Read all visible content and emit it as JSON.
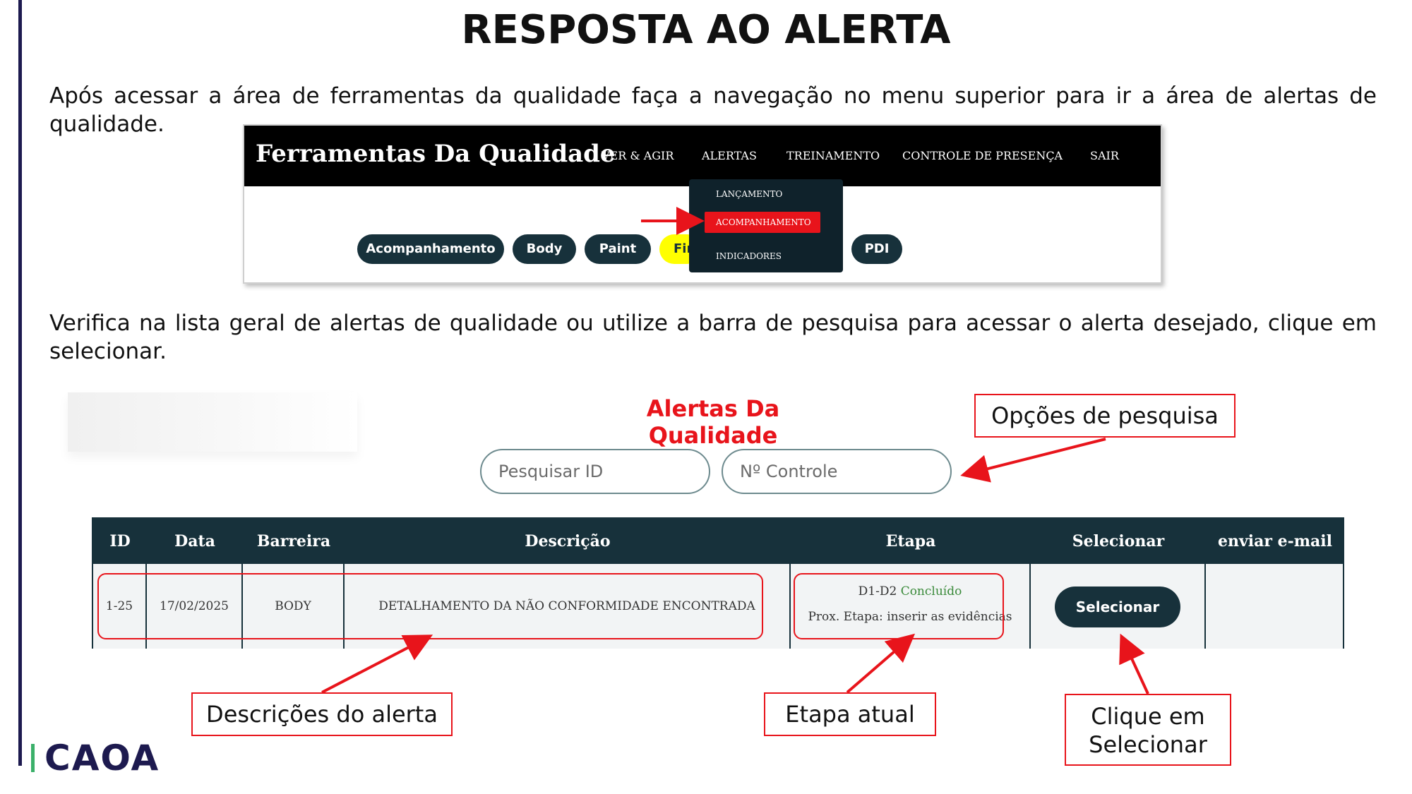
{
  "slide": {
    "title": "RESPOSTA AO ALERTA",
    "paragraph1": "Após acessar a área de ferramentas da qualidade faça a navegação no menu superior para ir a área de alertas de qualidade.",
    "paragraph2": "Verifica na lista geral de alertas de qualidade ou utilize a barra de pesquisa para acessar o alerta desejado, clique em selecionar."
  },
  "screenshot1": {
    "brand": "Ferramentas Da Qualidade",
    "nav": [
      "VER & AGIR",
      "ALERTAS",
      "TREINAMENTO",
      "CONTROLE DE PRESENÇA",
      "SAIR"
    ],
    "dropdown": [
      "LANÇAMENTO",
      "ACOMPANHAMENTO",
      "INDICADORES"
    ],
    "pills": [
      "Acompanhamento",
      "Body",
      "Paint",
      "Fin",
      "PDI"
    ]
  },
  "screenshot2": {
    "title": "Alertas Da Qualidade",
    "search_id_placeholder": "Pesquisar ID",
    "search_control_placeholder": "Nº Controle",
    "columns": [
      "ID",
      "Data",
      "Barreira",
      "Descrição",
      "Etapa",
      "Selecionar",
      "enviar e-mail"
    ],
    "row": {
      "id": "1-25",
      "date": "17/02/2025",
      "barrier": "BODY",
      "description": "DETALHAMENTO DA NÃO CONFORMIDADE ENCONTRADA",
      "stage_code": "D1-D2",
      "stage_status": "Concluído",
      "next_stage": "Prox. Etapa: inserir as evidências",
      "select_label": "Selecionar",
      "email": ""
    }
  },
  "callouts": {
    "search_options": "Opções de pesquisa",
    "alert_descriptions": "Descrições do alerta",
    "current_stage": "Etapa atual",
    "click_select": "Clique em Selecionar"
  },
  "logo": "CAOA",
  "colors": {
    "accent_red": "#e8141b",
    "dark_teal": "#17313b",
    "brand_navy": "#1d1a4f",
    "highlight_yellow": "#ffff00"
  }
}
